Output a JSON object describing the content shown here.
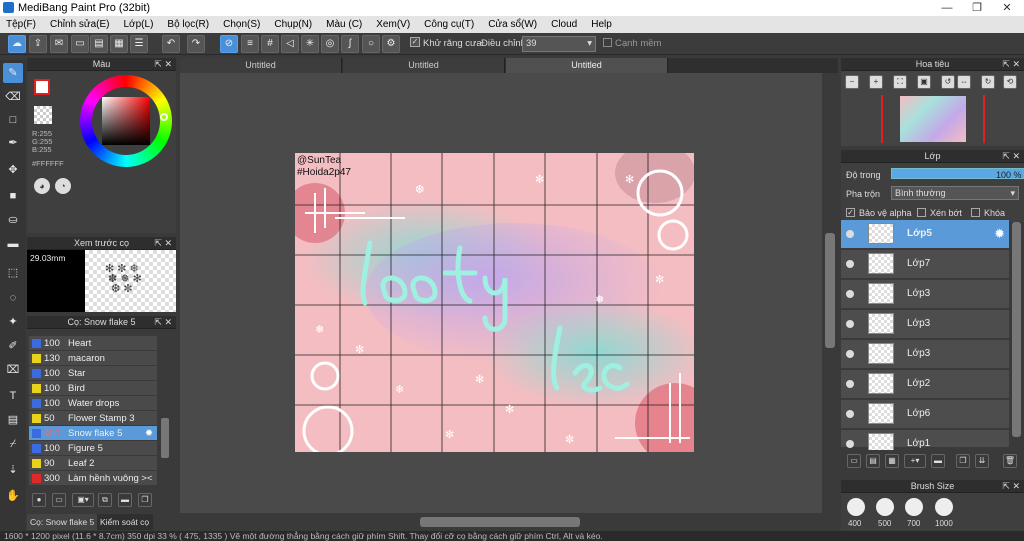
{
  "app": {
    "title": "MediBang Paint Pro (32bit)"
  },
  "menu": [
    "Tệp(F)",
    "Chỉnh sửa(E)",
    "Lớp(L)",
    "Bộ lọc(R)",
    "Chọn(S)",
    "Chụp(N)",
    "Màu (C)",
    "Xem(V)",
    "Công cụ(T)",
    "Cửa sổ(W)",
    "Cloud",
    "Help"
  ],
  "toolbar": {
    "antialias": "Khử răng cưa",
    "adjust_label": "Điều chỉnh",
    "adjust_value": "39",
    "edge": "Cạnh mềm"
  },
  "color_panel": {
    "title": "Màu",
    "r": "R:255",
    "g": "G:255",
    "b": "B:255",
    "hex": "#FFFFFF"
  },
  "preview_panel": {
    "title": "Xem trước cọ",
    "size": "29.03mm"
  },
  "brush_panel": {
    "title": "Cọ: Snow flake 5",
    "items": [
      {
        "size": "100",
        "name": "Heart",
        "color": "#3b6be0"
      },
      {
        "size": "130",
        "name": "macaron",
        "color": "#e8d21a"
      },
      {
        "size": "100",
        "name": "Star",
        "color": "#3b6be0"
      },
      {
        "size": "100",
        "name": "Bird",
        "color": "#e8d21a"
      },
      {
        "size": "100",
        "name": "Water drops",
        "color": "#3b6be0"
      },
      {
        "size": "50",
        "name": "Flower Stamp 3",
        "color": "#e8d21a"
      },
      {
        "size": "400",
        "name": "Snow flake 5",
        "color": "#3b6be0"
      },
      {
        "size": "100",
        "name": "Figure 5",
        "color": "#3b6be0"
      },
      {
        "size": "90",
        "name": "Leaf 2",
        "color": "#e8d21a"
      },
      {
        "size": "300",
        "name": "Làm hềnh vuông ><",
        "color": "#e02a2a"
      }
    ]
  },
  "bottom_tabs": [
    "Cọ: Snow flake 5",
    "Kiểm soát cọ"
  ],
  "doc_tabs": [
    "Untitled",
    "Untitled",
    "Untitled"
  ],
  "canvas": {
    "text1": "@SunTea",
    "text2": "#Hoida2p47",
    "word1": "loấtý",
    "word2": "lẹc"
  },
  "navigator": {
    "title": "Hoa tiêu"
  },
  "layer_panel": {
    "title": "Lớp",
    "opacity_label": "Độ trong",
    "opacity_value": "100 %",
    "blend_label": "Pha trộn",
    "blend_value": "Bình thường",
    "protect_alpha": "Bảo vệ alpha",
    "clip": "Xén bớt",
    "lock": "Khóa",
    "layers": [
      "Lớp5",
      "Lớp7",
      "Lớp3",
      "Lớp3",
      "Lớp3",
      "Lớp2",
      "Lớp6",
      "Lớp1"
    ]
  },
  "brush_size_panel": {
    "title": "Brush Size",
    "sizes": [
      "400",
      "500",
      "700",
      "1000"
    ]
  },
  "status": "1600 * 1200 pixel   (11.6 * 8.7cm)   350 dpi   33 %   ( 475, 1335 )   Vẽ một đường thẳng bằng cách giữ phím Shift. Thay đổi cỡ cọ bằng cách giữ phím Ctrl, Alt và kéo."
}
